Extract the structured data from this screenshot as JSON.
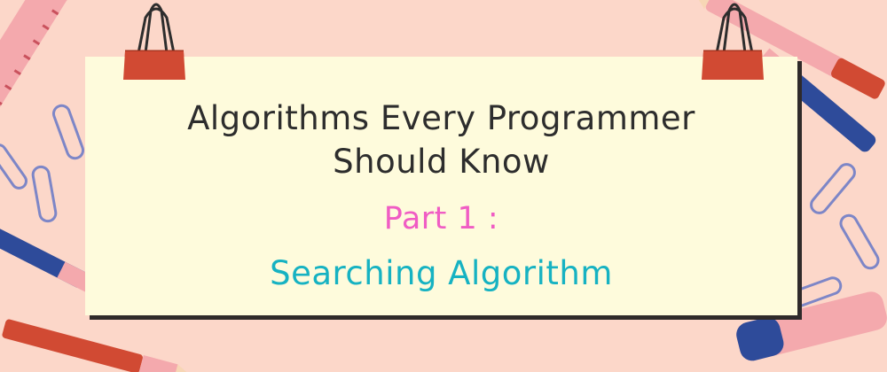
{
  "card": {
    "title_line1": "Algorithms Every Programmer",
    "title_line2": "Should Know",
    "part_label": "Part 1 :",
    "topic": "Searching Algorithm"
  },
  "colors": {
    "background": "#fcd7c9",
    "card": "#fefbdc",
    "title": "#2d2d2d",
    "part_label": "#f05cc4",
    "topic": "#16b2c2",
    "clip": "#d14a33"
  }
}
